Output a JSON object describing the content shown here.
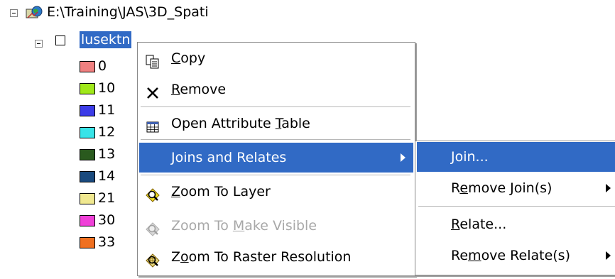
{
  "tree": {
    "root_path": "E:\\Training\\JAS\\3D_Spati",
    "layer_name": "lusektn",
    "legend": [
      {
        "value": "0",
        "color": "#f08080"
      },
      {
        "value": "10",
        "color": "#a0e81a"
      },
      {
        "value": "11",
        "color": "#3c3ce8"
      },
      {
        "value": "12",
        "color": "#38e4e8"
      },
      {
        "value": "13",
        "color": "#2a5a1e"
      },
      {
        "value": "14",
        "color": "#1a4a7e"
      },
      {
        "value": "21",
        "color": "#f0e890"
      },
      {
        "value": "30",
        "color": "#f040d8"
      },
      {
        "value": "33",
        "color": "#f07020"
      }
    ]
  },
  "context_menu": {
    "items": [
      {
        "name": "copy",
        "pre": "",
        "u": "C",
        "post": "opy",
        "icon": "copy-icon"
      },
      {
        "name": "remove",
        "pre": "",
        "u": "R",
        "post": "emove",
        "icon": "remove-icon"
      },
      {
        "name": "open-attribute-table",
        "pre": "Open Attribute ",
        "u": "T",
        "post": "able",
        "icon": "table-icon"
      },
      {
        "name": "joins-and-relates",
        "pre": "",
        "u": "J",
        "post": "oins and Relates",
        "icon": ""
      },
      {
        "name": "zoom-to-layer",
        "pre": "",
        "u": "Z",
        "post": "oom To Layer",
        "icon": "zoom-to-layer-icon"
      },
      {
        "name": "zoom-to-make-visible",
        "pre": "Zoom To ",
        "u": "M",
        "post": "ake Visible",
        "icon": "zoom-visible-icon"
      },
      {
        "name": "zoom-to-raster-resolution",
        "pre": "Z",
        "u": "o",
        "post": "om To Raster Resolution",
        "icon": "zoom-raster-icon"
      }
    ]
  },
  "submenu": {
    "items": [
      {
        "name": "join",
        "pre": "",
        "u": "J",
        "post": "oin..."
      },
      {
        "name": "remove-joins",
        "pre": "R",
        "u": "e",
        "post": "move Join(s)"
      },
      {
        "name": "relate",
        "pre": "",
        "u": "R",
        "post": "elate..."
      },
      {
        "name": "remove-relates",
        "pre": "Re",
        "u": "m",
        "post": "ove Relate(s)"
      }
    ]
  },
  "colors": {
    "highlight": "#316ac5",
    "disabled_text": "#a8a8a8"
  }
}
